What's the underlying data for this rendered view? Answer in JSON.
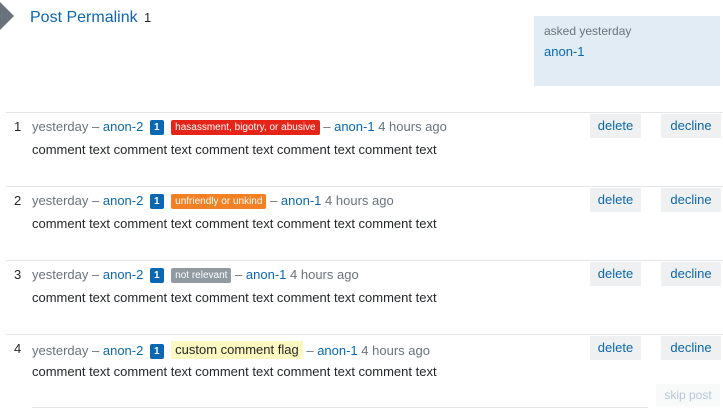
{
  "post": {
    "title": "Post Permalink",
    "count": "1"
  },
  "asked": {
    "label": "asked",
    "time": "yesterday",
    "user": "anon-1"
  },
  "colors": {
    "link": "#0a67b1",
    "flag_abusive": "#e6251a",
    "flag_unfriendly": "#f48024",
    "flag_not_relevant": "#9199a1",
    "flag_custom": "#fdf7c0",
    "asked_bg": "#e1ecf4"
  },
  "flags": [
    {
      "index": "1",
      "time": "yesterday",
      "dash1": "–",
      "flagger": "anon-2",
      "badge": "1",
      "flag_label": "hasassment, bigotry, or abusive",
      "flag_color": "#e6251a",
      "dash2": "–",
      "author": "anon-1",
      "author_time": "4 hours ago",
      "comment": "comment text comment text comment text comment text comment text",
      "delete_label": "delete",
      "decline_label": "decline"
    },
    {
      "index": "2",
      "time": "yesterday",
      "dash1": "–",
      "flagger": "anon-2",
      "badge": "1",
      "flag_label": "unfriendly or unkind",
      "flag_color": "#f48024",
      "dash2": "–",
      "author": "anon-1",
      "author_time": "4 hours ago",
      "comment": "comment text comment text comment text comment text comment text",
      "delete_label": "delete",
      "decline_label": "decline"
    },
    {
      "index": "3",
      "time": "yesterday",
      "dash1": "–",
      "flagger": "anon-2",
      "badge": "1",
      "flag_label": "not relevant",
      "flag_color": "#9199a1",
      "dash2": "–",
      "author": "anon-1",
      "author_time": "4 hours ago",
      "comment": "comment text comment text comment text comment text comment text",
      "delete_label": "delete",
      "decline_label": "decline"
    },
    {
      "index": "4",
      "time": "yesterday",
      "dash1": "–",
      "flagger": "anon-2",
      "badge": "1",
      "flag_label": "custom comment flag",
      "flag_color": "#fdf7c0",
      "dash2": "–",
      "author": "anon-1",
      "author_time": "4 hours ago",
      "comment": "comment text comment text comment text comment text comment text",
      "delete_label": "delete",
      "decline_label": "decline"
    }
  ],
  "skip_label": "skip post"
}
